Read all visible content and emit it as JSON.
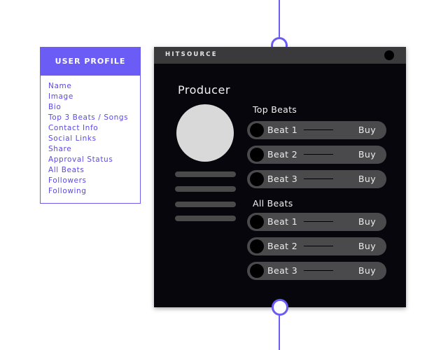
{
  "profile_card": {
    "title": "USER PROFILE",
    "fields": [
      "Name",
      "Image",
      "Bio",
      "Top 3 Beats / Songs",
      "Contact Info",
      "Social Links",
      "Share",
      "Approval Status",
      "All Beats",
      "Followers",
      "Following"
    ]
  },
  "app": {
    "brand": "HITSOURCE",
    "page_title": "Producer",
    "top_beats": {
      "label": "Top Beats",
      "items": [
        {
          "name": "Beat 1",
          "action": "Buy"
        },
        {
          "name": "Beat 2",
          "action": "Buy"
        },
        {
          "name": "Beat 3",
          "action": "Buy"
        }
      ]
    },
    "all_beats": {
      "label": "All Beats",
      "items": [
        {
          "name": "Beat 1",
          "action": "Buy"
        },
        {
          "name": "Beat 2",
          "action": "Buy"
        },
        {
          "name": "Beat 3",
          "action": "Buy"
        }
      ]
    }
  },
  "colors": {
    "accent": "#6b5cf6",
    "app_background": "#07060c",
    "pill": "#4a4a4c",
    "avatar_placeholder": "#d9d9d9"
  }
}
